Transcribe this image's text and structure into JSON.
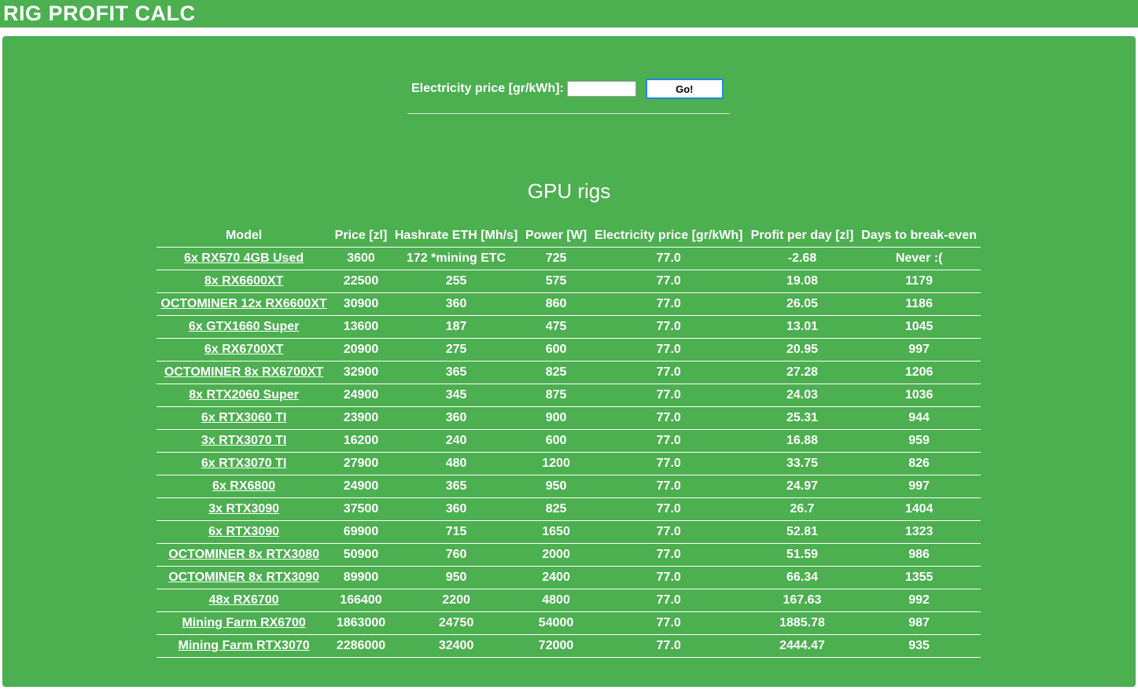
{
  "header": {
    "title": "RIG PROFIT CALC"
  },
  "form": {
    "label": "Electricity price [gr/kWh]:",
    "input_value": "",
    "button_label": "Go!"
  },
  "section": {
    "title": "GPU rigs"
  },
  "table": {
    "columns": [
      "Model",
      "Price [zl]",
      "Hashrate ETH [Mh/s]",
      "Power [W]",
      "Electricity price [gr/kWh]",
      "Profit per day [zl]",
      "Days to break-even"
    ],
    "rows": [
      [
        "6x RX570 4GB Used",
        "3600",
        "172 *mining ETC",
        "725",
        "77.0",
        "-2.68",
        "Never :("
      ],
      [
        "8x RX6600XT",
        "22500",
        "255",
        "575",
        "77.0",
        "19.08",
        "1179"
      ],
      [
        "OCTOMINER 12x RX6600XT",
        "30900",
        "360",
        "860",
        "77.0",
        "26.05",
        "1186"
      ],
      [
        "6x GTX1660 Super",
        "13600",
        "187",
        "475",
        "77.0",
        "13.01",
        "1045"
      ],
      [
        "6x RX6700XT",
        "20900",
        "275",
        "600",
        "77.0",
        "20.95",
        "997"
      ],
      [
        "OCTOMINER 8x RX6700XT",
        "32900",
        "365",
        "825",
        "77.0",
        "27.28",
        "1206"
      ],
      [
        "8x RTX2060 Super",
        "24900",
        "345",
        "875",
        "77.0",
        "24.03",
        "1036"
      ],
      [
        "6x RTX3060 TI",
        "23900",
        "360",
        "900",
        "77.0",
        "25.31",
        "944"
      ],
      [
        "3x RTX3070 TI",
        "16200",
        "240",
        "600",
        "77.0",
        "16.88",
        "959"
      ],
      [
        "6x RTX3070 TI",
        "27900",
        "480",
        "1200",
        "77.0",
        "33.75",
        "826"
      ],
      [
        "6x RX6800",
        "24900",
        "365",
        "950",
        "77.0",
        "24.97",
        "997"
      ],
      [
        "3x RTX3090",
        "37500",
        "360",
        "825",
        "77.0",
        "26.7",
        "1404"
      ],
      [
        "6x RTX3090",
        "69900",
        "715",
        "1650",
        "77.0",
        "52.81",
        "1323"
      ],
      [
        "OCTOMINER 8x RTX3080",
        "50900",
        "760",
        "2000",
        "77.0",
        "51.59",
        "986"
      ],
      [
        "OCTOMINER 8x RTX3090",
        "89900",
        "950",
        "2400",
        "77.0",
        "66.34",
        "1355"
      ],
      [
        "48x RX6700",
        "166400",
        "2200",
        "4800",
        "77.0",
        "167.63",
        "992"
      ],
      [
        "Mining Farm RX6700",
        "1863000",
        "24750",
        "54000",
        "77.0",
        "1885.78",
        "987"
      ],
      [
        "Mining Farm RTX3070",
        "2286000",
        "32400",
        "72000",
        "77.0",
        "2444.47",
        "935"
      ]
    ]
  },
  "colors": {
    "background": "#4caf50",
    "text": "#ffffff",
    "button_border": "#1e88e5"
  }
}
